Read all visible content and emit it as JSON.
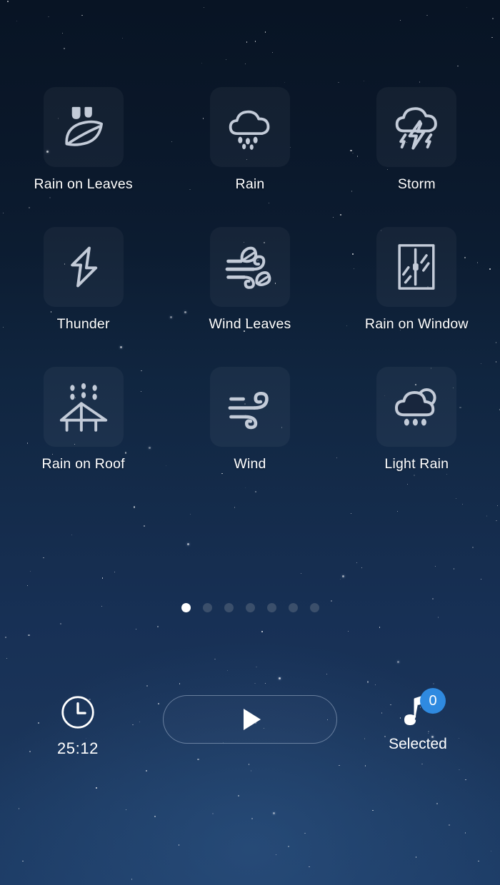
{
  "app": {
    "background_top_color": "#081424",
    "background_bottom_color": "#1d3c66",
    "tile_color": "rgba(255,255,255,0.045)",
    "icon_color": "#c3cbd8",
    "accent_color": "#2f8ae0"
  },
  "grid": {
    "items": [
      {
        "label": "Rain on Leaves",
        "icon": "rain-on-leaves-icon"
      },
      {
        "label": "Rain",
        "icon": "rain-cloud-icon"
      },
      {
        "label": "Storm",
        "icon": "storm-cloud-lightning-icon"
      },
      {
        "label": "Thunder",
        "icon": "lightning-bolt-icon"
      },
      {
        "label": "Wind Leaves",
        "icon": "wind-leaves-icon"
      },
      {
        "label": "Rain on Window",
        "icon": "rain-on-window-icon"
      },
      {
        "label": "Rain on Roof",
        "icon": "rain-on-roof-icon"
      },
      {
        "label": "Wind",
        "icon": "wind-icon"
      },
      {
        "label": "Light Rain",
        "icon": "light-rain-sun-cloud-icon"
      }
    ]
  },
  "pagination": {
    "total": 7,
    "active_index": 0,
    "active_color": "#ffffff",
    "inactive_color": "#3b4f6b"
  },
  "controls": {
    "timer": {
      "icon": "clock-icon",
      "value": "25:12"
    },
    "play": {
      "icon": "play-triangle-icon",
      "label": ""
    },
    "selected": {
      "icon": "music-note-icon",
      "count": "0",
      "label": "Selected"
    }
  }
}
